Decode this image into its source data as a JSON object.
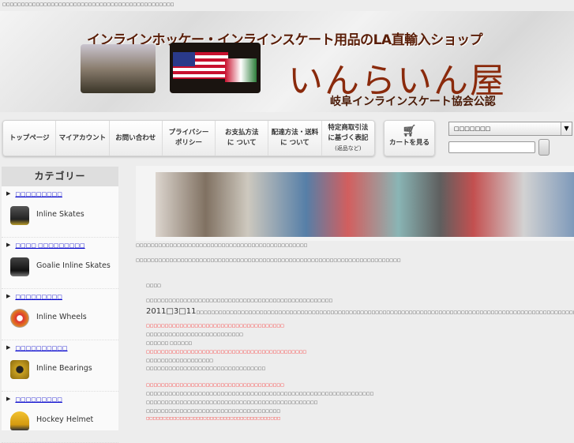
{
  "top_text": "□□□□□□□□□□□□□□□□□□□□□□□□□□□□□□□□□□□□□□□□□□□□□□",
  "banner": {
    "tagline": "インラインホッケー・インラインスケート用品のLA直輸入ショップ",
    "logo": "いんらいん屋",
    "subtitle": "岐阜インラインスケート協会公認"
  },
  "nav": [
    {
      "l1": "トップページ"
    },
    {
      "l1": "マイアカウント"
    },
    {
      "l1": "お問い合わせ"
    },
    {
      "l1": "プライバシー",
      "l2": "ポリシー"
    },
    {
      "l1": "お支払方法",
      "l2": "に ついて"
    },
    {
      "l1": "配達方法・送料",
      "l2": "に ついて"
    },
    {
      "l1": "特定商取引法",
      "l2": "に基づく表記",
      "l3": "(返品など)"
    }
  ],
  "cart": {
    "icon": "cart-icon",
    "label": "カートを見る"
  },
  "search": {
    "select_value": "□□□□□□□",
    "query": ""
  },
  "sidebar": {
    "title": "カテゴリー",
    "items": [
      {
        "link": "□□□□□□□□□",
        "name": "Inline Skates"
      },
      {
        "link": "□□□□ □□□□□□□□□",
        "name": "Goalie Inline Skates"
      },
      {
        "link": "□□□□□□□□□",
        "name": "Inline  Wheels"
      },
      {
        "link": "□□□□□□□□□□",
        "name": "Inline Bearings"
      },
      {
        "link": "□□□□□□□□□",
        "name": "Hockey Helmet"
      }
    ]
  },
  "content": {
    "line1": "□□□□□□□□□□□□□□□□□□□□□□□□□□□□□□□□□□□□□□□□□□□□□□",
    "line2": "□□□□□□□□□□□□□□□□□□□□□□□□□□□□□□□□□□□□□□□□□□□□□□□□□□□□□□□□□□□□□□□□□□□□□□□",
    "notice_title": "□□□□",
    "p1": "□□□□□□□□□□□□□□□□□□□□□□□□□□□□□□□□□□□□□□□□□□□□□□□□□□",
    "date_prefix": "2011□3□11",
    "date_rest": "□□□□□□□□□□□□□□□□□□□□□□□□□□□□□□□□□□□□□□□□□□□□□□□□□□□□□□□□□□□□□□□□□□□□□□□□□□□□□□□□□□□□□□□□□□□□□□□□□□□□□□□",
    "red1": "□□□□□□□□□□□□□□□□□□□□□□□□□□□□□□□□□□□□□",
    "l2": "□□□□□□□□□□□□□□□□□□□□□□□□□□",
    "l3": "□□□□□□ □□□□□□",
    "red2": "□□□□□□□□□□□□□□□□□□□□□□□□□□□□□□□□□□□□□□□□□□□",
    "l5": "□□□□□□□□□□□□□□□□□□",
    "l6": "□□□□□□□□□□□□□□□□□□□□□□□□□□□□□□□□",
    "red3": "□□□□□□□□□□□□□□□□□□□□□□□□□□□□□□□□□□□□□",
    "l8": "□□□□□□□□□□□□□□□□□□□□□□□□□□□□□□□□□□□□□□□□□□□□□□□□□□□□□□□□□□□□□",
    "l9": "□□□□□□□□□□□□□□□□□□□□□□□□□□□□□□□□□□□□□□□□□□□□□□",
    "l10": "□□□□□□□□□□□□□□□□□□□□□□□□□□□□□□□□□□□□",
    "red4": "□□□□□□□□□□□□□□□□□□□□□□□□□□□□□□□□□□□□□□□□"
  }
}
